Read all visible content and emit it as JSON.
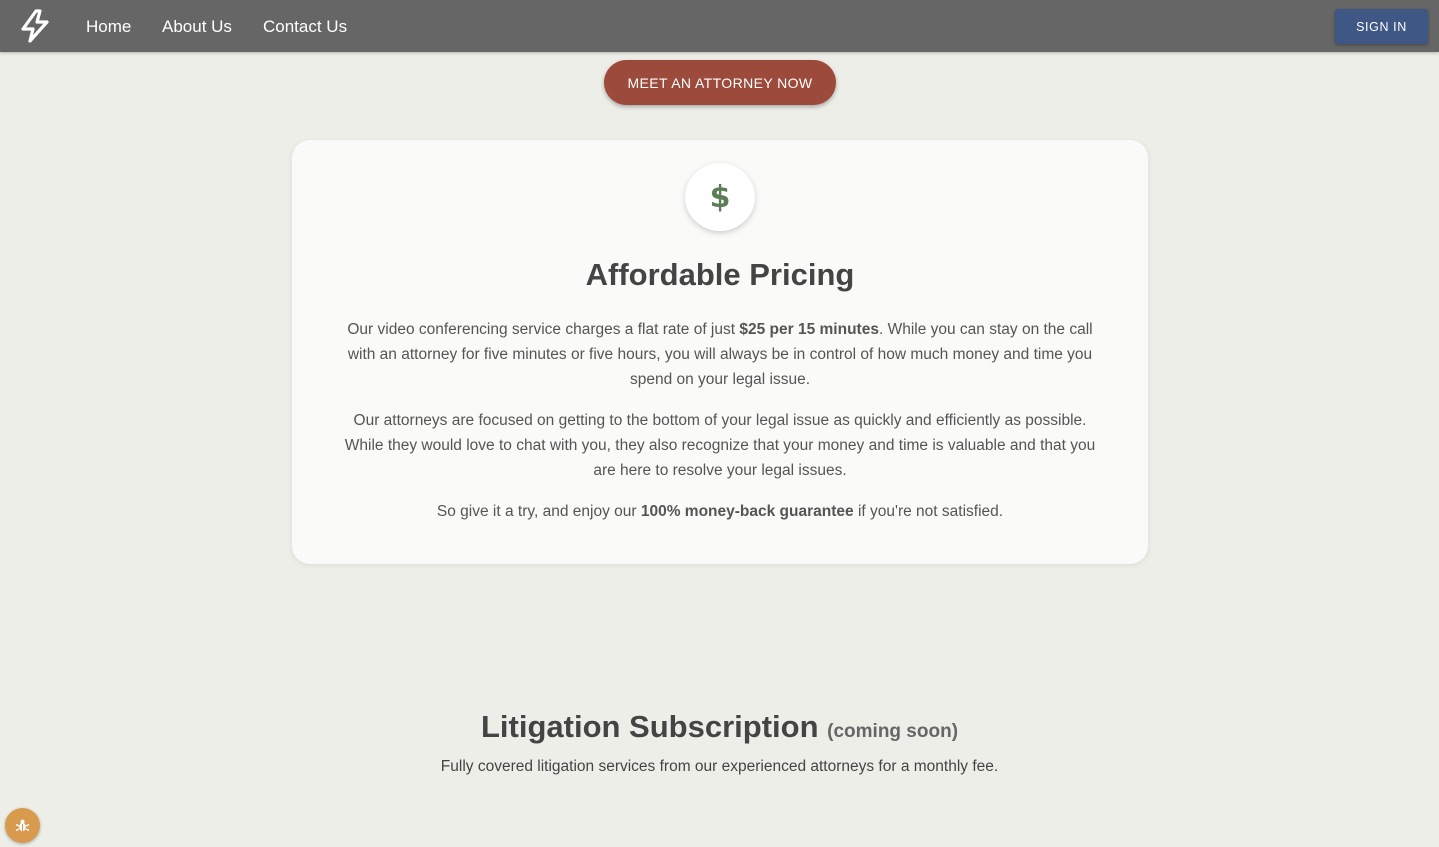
{
  "nav": {
    "logo_icon": "lightning-bolt-icon",
    "links": [
      "Home",
      "About Us",
      "Contact Us"
    ],
    "signin_label": "SIGN IN"
  },
  "cta": {
    "label": "MEET AN ATTORNEY NOW"
  },
  "pricing": {
    "icon": "dollar-sign-icon",
    "title": "Affordable Pricing",
    "p1_before": "Our video conferencing service charges a flat rate of just ",
    "p1_bold": "$25 per 15 minutes",
    "p1_after": ". While you can stay on the call with an attorney for five minutes or five hours, you will always be in control of how much money and time you spend on your legal issue.",
    "p2": "Our attorneys are focused on getting to the bottom of your legal issue as quickly and efficiently as possible. While they would love to chat with you, they also recognize that your money and time is valuable and that you are here to resolve your legal issues.",
    "p3_before": "So give it a try, and enjoy our ",
    "p3_bold": "100% money-back guarantee",
    "p3_after": " if you're not satisfied."
  },
  "litigation": {
    "title": "Litigation Subscription",
    "coming_soon": "(coming soon)",
    "subtitle": "Fully covered litigation services from our experienced attorneys for a monthly fee."
  },
  "debug": {
    "icon": "bug-icon"
  },
  "colors": {
    "nav_bg": "#666666",
    "signin_bg": "#3f5784",
    "cta_bg": "#9c4a3b",
    "dollar_green": "#5a7d57",
    "page_bg": "#eeeee9",
    "bug_button_bg": "#d89a4c"
  }
}
